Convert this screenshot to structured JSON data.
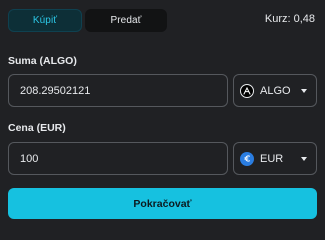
{
  "tabs": [
    {
      "label": "Kúpiť",
      "active": true
    },
    {
      "label": "Predať",
      "active": false
    }
  ],
  "rate": {
    "text": "Kurz: 0,48"
  },
  "amount_field": {
    "label": "Suma (ALGO)",
    "value": "208.29502121",
    "currency": {
      "code": "ALGO",
      "icon": "algorand-icon"
    }
  },
  "price_field": {
    "label": "Cena (EUR)",
    "value": "100",
    "currency": {
      "code": "EUR",
      "icon": "euro-icon"
    }
  },
  "continue_button": {
    "label": "Pokračovať"
  },
  "colors": {
    "accent": "#16c1e0",
    "active_tab_text": "#2cc7e6",
    "background": "#202124",
    "euro_icon": "#2a7de1"
  }
}
